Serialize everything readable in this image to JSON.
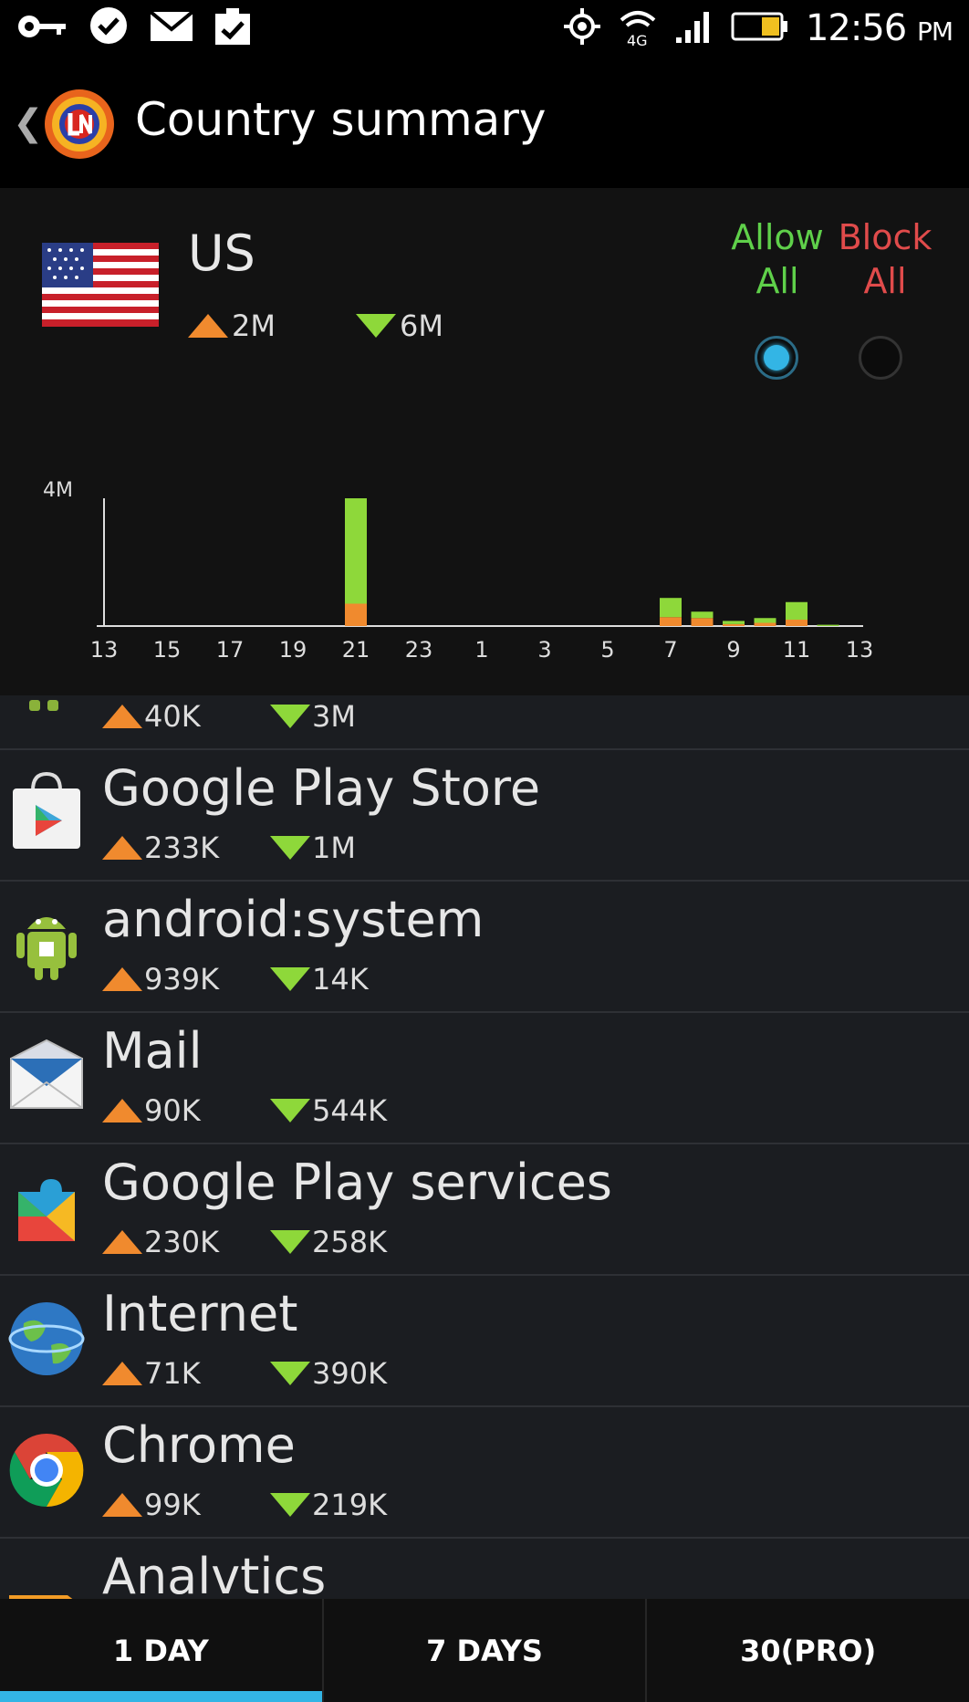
{
  "status_bar": {
    "time": "12:56",
    "ampm": "PM",
    "network": "4G",
    "icons": [
      "key-icon",
      "check-bubble-icon",
      "mail-icon",
      "tasks-icon",
      "gps-icon",
      "wifi-4g-icon",
      "signal-icon",
      "battery-icon"
    ]
  },
  "action_bar": {
    "title": "Country summary",
    "icons": [
      "back-chevron-icon",
      "app-logo-icon"
    ]
  },
  "country": {
    "name": "US",
    "upload": "2M",
    "download": "6M",
    "allow_line1": "Allow",
    "allow_line2": "All",
    "block_line1": "Block",
    "block_line2": "All",
    "allow_selected": true,
    "colors": {
      "allow": "#5fd04a",
      "block": "#e04b4b",
      "accent": "#33b5e5",
      "upload": "#f08a2e",
      "download": "#8ed83a"
    }
  },
  "chart_data": {
    "type": "bar",
    "stacked": true,
    "ymax_label": "4M",
    "ylim": [
      0,
      4
    ],
    "x_tick_labels": [
      "13",
      "15",
      "17",
      "19",
      "21",
      "23",
      "1",
      "3",
      "5",
      "7",
      "9",
      "11",
      "13"
    ],
    "categories": [
      "13",
      "14",
      "15",
      "16",
      "17",
      "18",
      "19",
      "20",
      "21",
      "22",
      "23",
      "0",
      "1",
      "2",
      "3",
      "4",
      "5",
      "6",
      "7",
      "8",
      "9",
      "10",
      "11",
      "12",
      "13"
    ],
    "series": [
      {
        "color": "#f08a2e",
        "values": [
          0,
          0,
          0,
          0,
          0,
          0,
          0,
          0,
          0.7,
          0,
          0,
          0,
          0,
          0,
          0,
          0,
          0,
          0,
          0.28,
          0.25,
          0.06,
          0.1,
          0.2,
          0,
          0
        ]
      },
      {
        "color": "#8ed83a",
        "values": [
          0,
          0,
          0,
          0,
          0,
          0,
          0,
          0,
          3.3,
          0,
          0,
          0,
          0,
          0,
          0,
          0,
          0,
          0,
          0.6,
          0.2,
          0.1,
          0.15,
          0.55,
          0.04,
          0
        ]
      }
    ]
  },
  "partial_row": {
    "upload": "40K",
    "download": "3M"
  },
  "apps": [
    {
      "name": "Google Play Store",
      "upload": "233K",
      "download": "1M",
      "icon": "play-store-icon"
    },
    {
      "name": "android:system",
      "upload": "939K",
      "download": "14K",
      "icon": "android-icon"
    },
    {
      "name": "Mail",
      "upload": "90K",
      "download": "544K",
      "icon": "mail-app-icon"
    },
    {
      "name": "Google Play services",
      "upload": "230K",
      "download": "258K",
      "icon": "play-services-icon"
    },
    {
      "name": "Internet",
      "upload": "71K",
      "download": "390K",
      "icon": "globe-icon"
    },
    {
      "name": "Chrome",
      "upload": "99K",
      "download": "219K",
      "icon": "chrome-icon"
    },
    {
      "name": "Analvtics",
      "icon": "analytics-icon"
    }
  ],
  "tabs": [
    {
      "label": "1 DAY",
      "active": true
    },
    {
      "label": "7 DAYS",
      "active": false
    },
    {
      "label": "30(PRO)",
      "active": false
    }
  ]
}
